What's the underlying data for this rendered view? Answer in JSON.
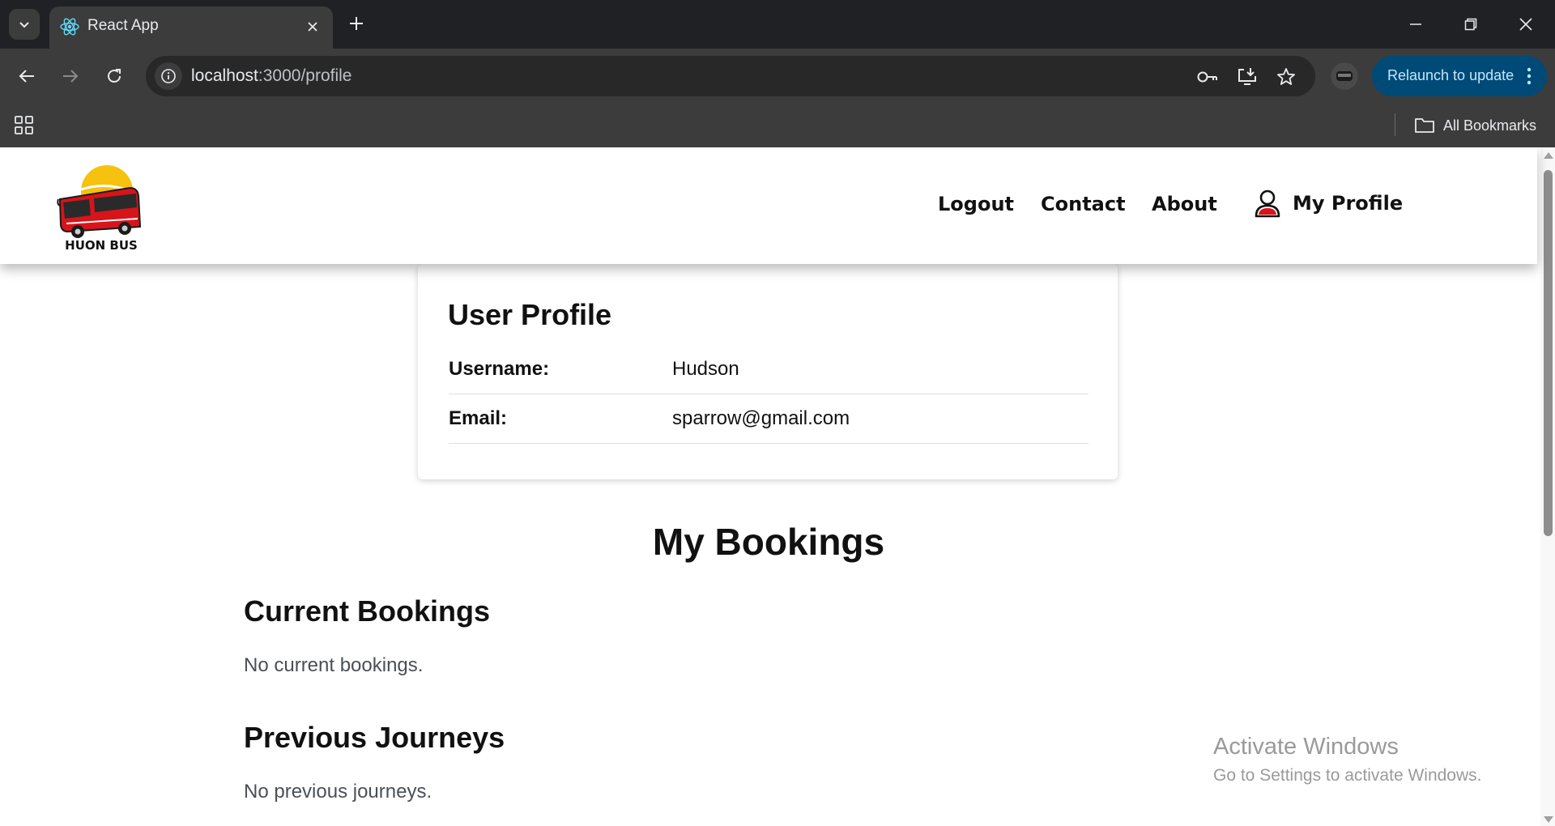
{
  "browser": {
    "tab_title": "React App",
    "url_host": "localhost",
    "url_path": ":3000/profile",
    "relaunch_label": "Relaunch to update",
    "bookmarks_label": "All Bookmarks"
  },
  "site": {
    "logo_text": "HUON BUS",
    "nav": {
      "logout": "Logout",
      "contact": "Contact",
      "about": "About",
      "my_profile": "My Profile"
    }
  },
  "profile": {
    "title": "User Profile",
    "rows": [
      {
        "label": "Username:",
        "value": "Hudson"
      },
      {
        "label": "Email:",
        "value": "sparrow@gmail.com"
      }
    ]
  },
  "bookings": {
    "title": "My Bookings",
    "current": {
      "title": "Current Bookings",
      "empty": "No current bookings."
    },
    "previous": {
      "title": "Previous Journeys",
      "empty": "No previous journeys."
    }
  },
  "watermark": {
    "title": "Activate Windows",
    "subtitle": "Go to Settings to activate Windows."
  },
  "colors": {
    "tabbar": "#202124",
    "toolbar": "#3c3c3c",
    "relaunch": "#004a77",
    "brand_red": "#d7141a",
    "brand_sun": "#f6c20f"
  }
}
